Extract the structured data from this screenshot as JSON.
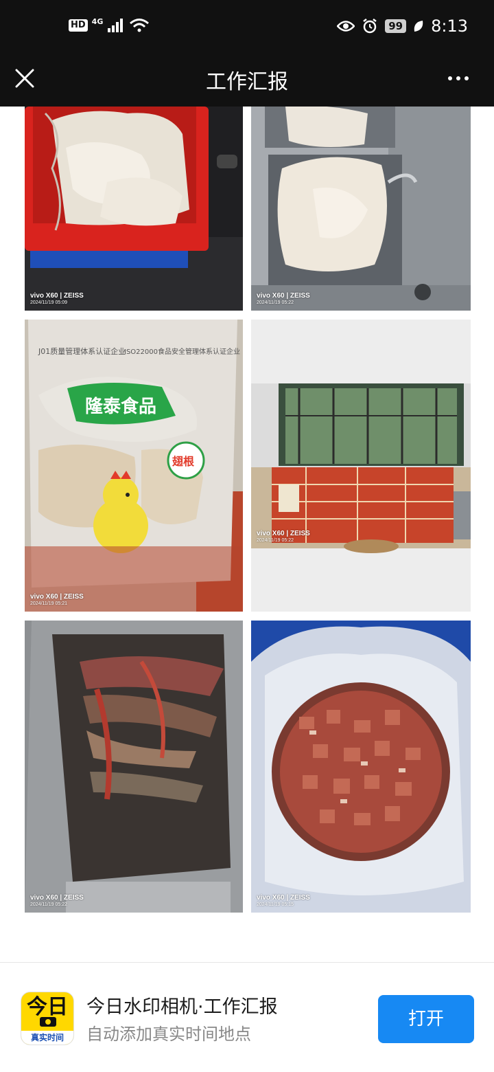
{
  "status_bar": {
    "hd_label": "HD",
    "network_label": "4G",
    "battery_level": "99",
    "time": "8:13"
  },
  "header": {
    "title": "工作汇报"
  },
  "photos": [
    {
      "camera": "vivo X60 | ZEISS",
      "date": "2024/11/19 05:09"
    },
    {
      "camera": "vivo X60 | ZEISS",
      "date": "2024/11/19 05:22"
    },
    {
      "camera": "vivo X60 | ZEISS",
      "date": "2024/11/19 05:21"
    },
    {
      "camera": "vivo X60 | ZEISS",
      "date": "2024/11/19 05:22"
    },
    {
      "camera": "vivo X60 | ZEISS",
      "date": "2024/11/19 05:22"
    },
    {
      "camera": "vivo X60 | ZEISS",
      "date": "2024/11/19 05:15"
    }
  ],
  "package": {
    "brand": "隆泰食品",
    "cert_left": "J01质量管理体系认证企业",
    "cert_right": "ISO22000食品安全管理体系认证企业",
    "stamp": "翅根"
  },
  "promo": {
    "app_icon_text": "今日",
    "app_icon_strip": "真实时间",
    "title": "今日水印相机·工作汇报",
    "subtitle": "自动添加真实时间地点",
    "open_label": "打开"
  },
  "colors": {
    "bar_bg": "#111111",
    "accent_button": "#1789f3",
    "app_icon": "#ffd800"
  }
}
